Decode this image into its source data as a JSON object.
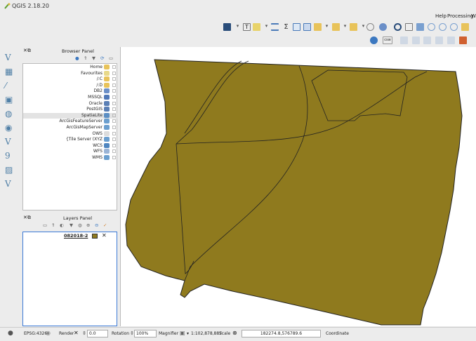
{
  "window": {
    "title": "QGIS 2.18.20"
  },
  "menu": {
    "help": "Help",
    "processing": "Processing",
    "web": "W"
  },
  "toolbar": {
    "text_annotation_icon": "T",
    "sum_icon": "Σ",
    "csv_icon": "csw"
  },
  "left_toolbar": {
    "items": [
      {
        "glyph": "V",
        "name": "add-vector-icon"
      },
      {
        "glyph": "▦",
        "name": "add-raster-icon"
      },
      {
        "glyph": "⁄",
        "name": "add-delimited-text-icon"
      },
      {
        "glyph": "▣",
        "name": "add-postgis-icon"
      },
      {
        "glyph": "◍",
        "name": "add-spatialite-icon"
      },
      {
        "glyph": "◉",
        "name": "add-wms-icon"
      },
      {
        "glyph": "V",
        "name": "add-wfs-icon"
      },
      {
        "glyph": "9",
        "name": "add-gps-icon"
      },
      {
        "glyph": "▨",
        "name": "add-mssql-icon"
      },
      {
        "glyph": "V",
        "name": "new-shapefile-icon"
      }
    ]
  },
  "browser_panel": {
    "title": "Browser Panel",
    "items": [
      {
        "label": "Home",
        "color": "#e8c35a"
      },
      {
        "label": "Favourites",
        "color": "#e8d98a"
      },
      {
        "label": "/:C",
        "color": "#e8c35a"
      },
      {
        "label": "/:D",
        "color": "#e8c35a"
      },
      {
        "label": "DB2",
        "color": "#6b8fc8"
      },
      {
        "label": "MSSQL",
        "color": "#4f78b8"
      },
      {
        "label": "Oracle",
        "color": "#5a7fb5"
      },
      {
        "label": "PostGIS",
        "color": "#5a7fb5"
      },
      {
        "label": "SpatiaLite",
        "color": "#5c8fc4"
      },
      {
        "label": "ArcGisFeatureServer",
        "color": "#6b9fcf"
      },
      {
        "label": "ArcGisMapServer",
        "color": "#6b9fcf"
      },
      {
        "label": "OWS",
        "color": "#dcdcdc"
      },
      {
        "label": "{Tile Server (XYZ",
        "color": "#6b9fcf"
      },
      {
        "label": "WCS",
        "color": "#4f86c0"
      },
      {
        "label": "WFS",
        "color": "#9ab4d6"
      },
      {
        "label": "WMS",
        "color": "#6b9fcf"
      }
    ],
    "selected_index": 8
  },
  "layers_panel": {
    "title": "Layers Panel",
    "layer_name": "082018-2",
    "layer_color": "#8f7a1e"
  },
  "map": {
    "fill_color": "#8f7a1e",
    "stroke_color": "#222222"
  },
  "status": {
    "crs": "EPSG:4326",
    "render_label": "Render",
    "rotation_value": "0.0",
    "rotation_label": "Rotation",
    "magnifier_value": "100%",
    "magnifier_label": "Magnifier",
    "scale_value": "1:102,878,887",
    "scale_label": "Scale",
    "coordinate_value": "182274.8,576789.6",
    "coordinate_label": "Coordinate"
  }
}
